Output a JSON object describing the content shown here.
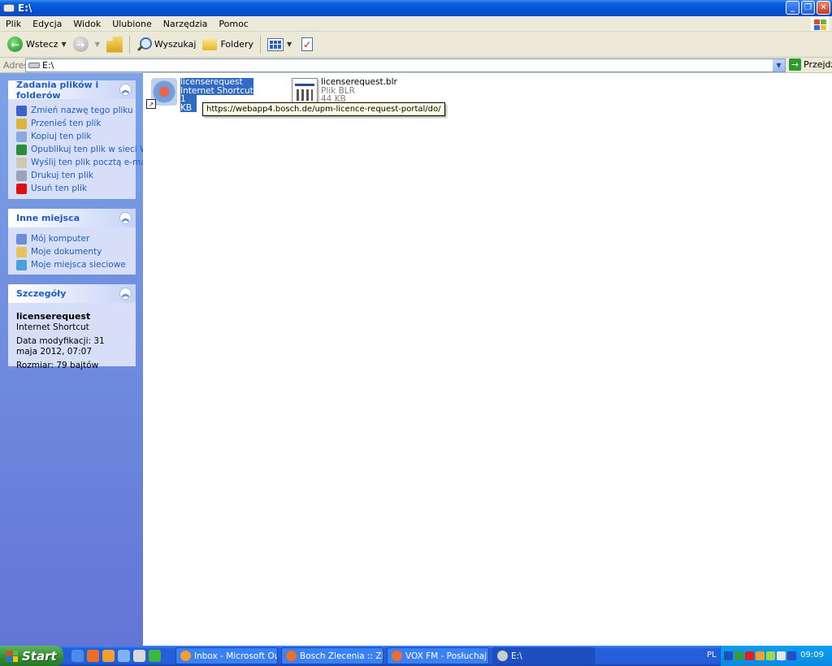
{
  "window": {
    "title": "E:\\"
  },
  "menu": [
    "Plik",
    "Edycja",
    "Widok",
    "Ulubione",
    "Narzędzia",
    "Pomoc"
  ],
  "toolbar": {
    "back_label": "Wstecz",
    "search_label": "Wyszukaj",
    "folders_label": "Foldery"
  },
  "address": {
    "label": "Adres",
    "value": "E:\\",
    "go_label": "Przejdź"
  },
  "tasks_panel": {
    "title": "Zadania plików i folderów",
    "items": [
      {
        "label": "Zmień nazwę tego pliku",
        "icon": "rename-icon",
        "color": "#3a64c8"
      },
      {
        "label": "Przenieś ten plik",
        "icon": "move-icon",
        "color": "#e2b33a"
      },
      {
        "label": "Kopiuj ten plik",
        "icon": "copy-icon",
        "color": "#8aa7de"
      },
      {
        "label": "Opublikuj ten plik w sieci Web",
        "icon": "globe-icon",
        "color": "#2e8b3a"
      },
      {
        "label": "Wyślij ten plik pocztą e-mail",
        "icon": "mail-icon",
        "color": "#cfc9b0"
      },
      {
        "label": "Drukuj ten plik",
        "icon": "printer-icon",
        "color": "#9aa3b8"
      },
      {
        "label": "Usuń ten plik",
        "icon": "delete-icon",
        "color": "#d11"
      }
    ]
  },
  "places_panel": {
    "title": "Inne miejsca",
    "items": [
      {
        "label": "Mój komputer",
        "icon": "computer-icon",
        "color": "#6b8fd4"
      },
      {
        "label": "Moje dokumenty",
        "icon": "documents-icon",
        "color": "#e6c45a"
      },
      {
        "label": "Moje miejsca sieciowe",
        "icon": "network-icon",
        "color": "#4aa0d8"
      }
    ]
  },
  "details_panel": {
    "title": "Szczegóły",
    "name": "licenserequest",
    "type": "Internet Shortcut",
    "modified": "Data modyfikacji: 31 maja 2012, 07:07",
    "size": "Rozmiar: 79 bajtów"
  },
  "files": [
    {
      "name": "licenserequest",
      "type": "Internet Shortcut",
      "size": "1 KB",
      "selected": true
    },
    {
      "name": "licenserequest.blr",
      "type": "Plik BLR",
      "size": "44 KB",
      "selected": false
    }
  ],
  "tooltip": "https://webapp4.bosch.de/upm-licence-request-portal/do/",
  "taskbar": {
    "start_label": "Start",
    "tasks": [
      {
        "label": "Inbox - Microsoft Out...",
        "icon_color": "#f0a030"
      },
      {
        "label": "Bosch Zlecenia :: Zlec...",
        "icon_color": "#e8702a"
      },
      {
        "label": "VOX FM - Posłuchaj O...",
        "icon_color": "#e8702a"
      },
      {
        "label": "E:\\",
        "icon_color": "#cccccc",
        "active": true
      }
    ],
    "language": "PL",
    "clock": "09:09"
  }
}
